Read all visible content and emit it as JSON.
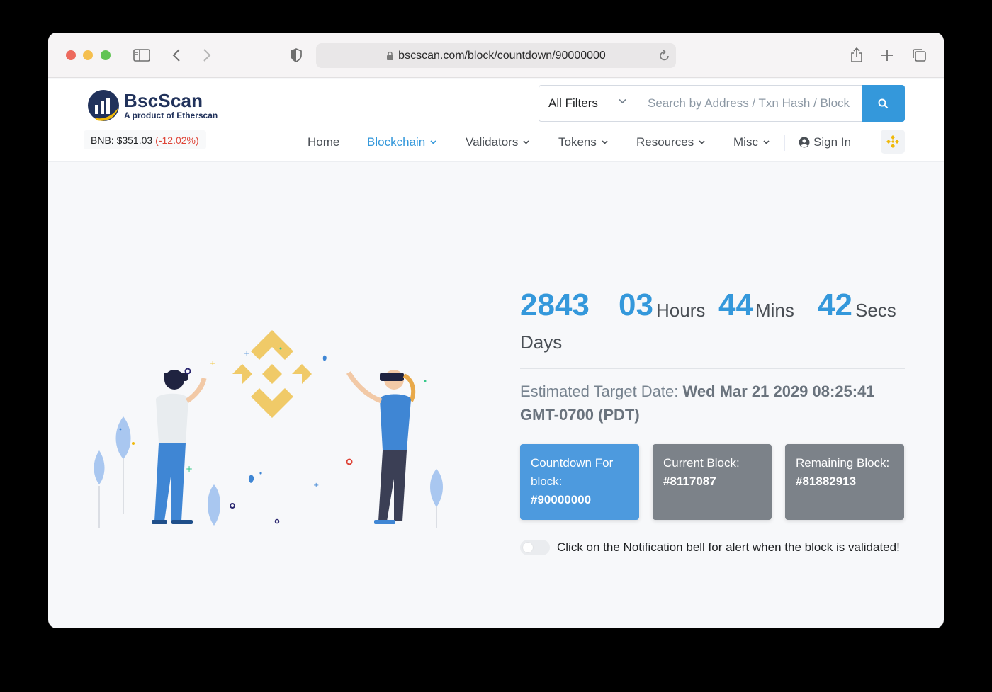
{
  "browser": {
    "url": "bscscan.com/block/countdown/90000000"
  },
  "site": {
    "logo_title": "BscScan",
    "logo_subtitle": "A product of Etherscan",
    "price_label": "BNB: $351.03",
    "price_change": "(-12.02%)",
    "search": {
      "filter_label": "All Filters",
      "placeholder": "Search by Address / Txn Hash / Block"
    },
    "nav": {
      "home": "Home",
      "blockchain": "Blockchain",
      "validators": "Validators",
      "tokens": "Tokens",
      "resources": "Resources",
      "misc": "Misc",
      "sign_in": "Sign In"
    }
  },
  "countdown": {
    "days": "2843",
    "days_unit": "Days",
    "hours": "03",
    "hours_unit": "Hours",
    "mins": "44",
    "mins_unit": "Mins",
    "secs": "42",
    "secs_unit": "Secs",
    "target_label": "Estimated Target Date:",
    "target_value": "Wed Mar 21 2029 08:25:41 GMT-0700 (PDT)"
  },
  "cards": {
    "countdown_label": "Countdown For block:",
    "countdown_value": "#90000000",
    "current_label": "Current Block:",
    "current_value": "#8117087",
    "remaining_label": "Remaining Block:",
    "remaining_value": "#81882913"
  },
  "notification_text": "Click on the Notification bell for alert when the block is validated!",
  "colors": {
    "accent": "#3498db",
    "negative": "#de4437",
    "binance_gold": "#f0b90b"
  }
}
